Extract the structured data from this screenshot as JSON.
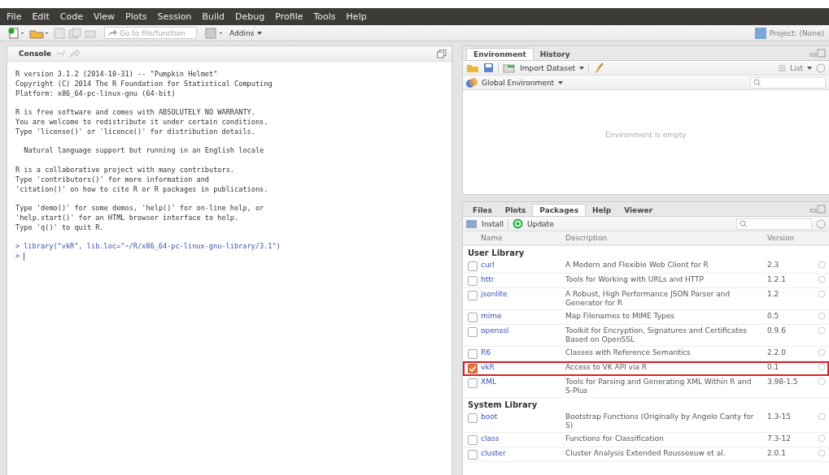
{
  "menu": [
    "File",
    "Edit",
    "Code",
    "View",
    "Plots",
    "Session",
    "Build",
    "Debug",
    "Profile",
    "Tools",
    "Help"
  ],
  "toolbar": {
    "goto_placeholder": "Go to file/function",
    "addins": "Addins",
    "project": "Project: (None)"
  },
  "console": {
    "title": "Console",
    "path": "~/",
    "blocks": [
      [
        "R version 3.1.2 (2014-10-31) -- \"Pumpkin Helmet\"",
        "Copyright (C) 2014 The R Foundation for Statistical Computing",
        "Platform: x86_64-pc-linux-gnu (64-bit)"
      ],
      [
        "R is free software and comes with ABSOLUTELY NO WARRANTY.",
        "You are welcome to redistribute it under certain conditions.",
        "Type 'license()' or 'licence()' for distribution details."
      ],
      [
        "  Natural language support but running in an English locale"
      ],
      [
        "R is a collaborative project with many contributors.",
        "Type 'contributors()' for more information and",
        "'citation()' on how to cite R or R packages in publications."
      ],
      [
        "Type 'demo()' for some demos, 'help()' for on-line help, or",
        "'help.start()' for an HTML browser interface to help.",
        "Type 'q()' to quit R."
      ]
    ],
    "commands": [
      {
        "prompt": ">",
        "text": "library(\"vkR\", lib.loc=\"~/R/x86_64-pc-linux-gnu-library/3.1\")"
      },
      {
        "prompt": ">"
      }
    ]
  },
  "env_tabs": [
    {
      "label": "Environment",
      "selected": true
    },
    {
      "label": "History",
      "selected": false
    }
  ],
  "env_toolbar": {
    "import": "Import Dataset",
    "view": "List",
    "scope": "Global Environment",
    "empty": "Environment is empty"
  },
  "pkg_tabs": [
    {
      "label": "Files",
      "selected": false
    },
    {
      "label": "Plots",
      "selected": false
    },
    {
      "label": "Packages",
      "selected": true
    },
    {
      "label": "Help",
      "selected": false
    },
    {
      "label": "Viewer",
      "selected": false
    }
  ],
  "pkg_toolbar": {
    "install": "Install",
    "update": "Update"
  },
  "pkg_columns": [
    "Name",
    "Description",
    "Version"
  ],
  "libraries": [
    {
      "title": "User Library",
      "packages": [
        {
          "name": "curl",
          "description": "A Modern and Flexible Web Client for R",
          "version": "2.3",
          "loaded": false,
          "highlighted": false
        },
        {
          "name": "httr",
          "description": "Tools for Working with URLs and HTTP",
          "version": "1.2.1",
          "loaded": false,
          "highlighted": false
        },
        {
          "name": "jsonlite",
          "description": "A Robust, High Performance JSON Parser and Generator for R",
          "version": "1.2",
          "loaded": false,
          "highlighted": false
        },
        {
          "name": "mime",
          "description": "Map Filenames to MIME Types",
          "version": "0.5",
          "loaded": false,
          "highlighted": false
        },
        {
          "name": "openssl",
          "description": "Toolkit for Encryption, Signatures and Certificates Based on OpenSSL",
          "version": "0.9.6",
          "loaded": false,
          "highlighted": false
        },
        {
          "name": "R6",
          "description": "Classes with Reference Semantics",
          "version": "2.2.0",
          "loaded": false,
          "highlighted": false
        },
        {
          "name": "vkR",
          "description": "Access to VK API via R",
          "version": "0.1",
          "loaded": true,
          "highlighted": true
        },
        {
          "name": "XML",
          "description": "Tools for Parsing and Generating XML Within R and S-Plus",
          "version": "3.98-1.5",
          "loaded": false,
          "highlighted": false
        }
      ]
    },
    {
      "title": "System Library",
      "packages": [
        {
          "name": "boot",
          "description": "Bootstrap Functions (Originally by Angelo Canty for S)",
          "version": "1.3-15",
          "loaded": false,
          "highlighted": false
        },
        {
          "name": "class",
          "description": "Functions for Classification",
          "version": "7.3-12",
          "loaded": false,
          "highlighted": false
        },
        {
          "name": "cluster",
          "description": "Cluster Analysis Extended Rousseeuw et al.",
          "version": "2.0.1",
          "loaded": false,
          "highlighted": false
        }
      ]
    }
  ]
}
